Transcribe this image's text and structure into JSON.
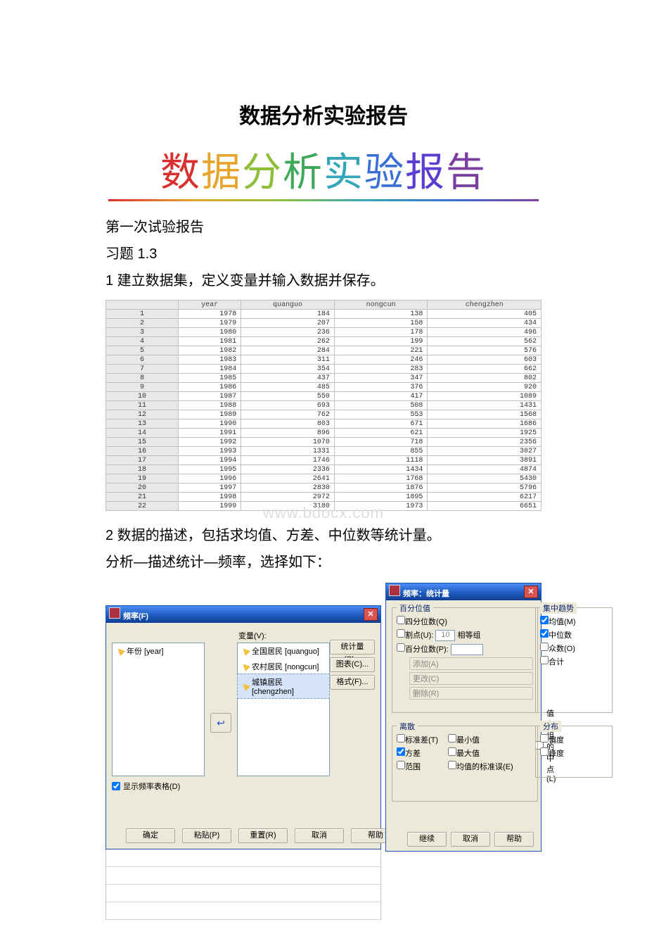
{
  "doc": {
    "title_plain": "数据分析实验报告",
    "section1": "第一次试验报告",
    "section2": "习题 1.3",
    "step1": "1 建立数据集，定义变量并输入数据并保存。",
    "step2": "2 数据的描述，包括求均值、方差、中位数等统计量。",
    "step3": "分析—描述统计—频率，选择如下：",
    "watermark": "www.bdocx.com"
  },
  "rainbow": [
    "数",
    "据",
    "分",
    "析",
    "实",
    "验",
    "报",
    "告"
  ],
  "table": {
    "headers": [
      "",
      "year",
      "quanguo",
      "nongcun",
      "chengzhen"
    ],
    "rows": [
      [
        1,
        1978,
        184,
        138,
        405
      ],
      [
        2,
        1979,
        207,
        158,
        434
      ],
      [
        3,
        1980,
        236,
        178,
        496
      ],
      [
        4,
        1981,
        262,
        199,
        562
      ],
      [
        5,
        1982,
        284,
        221,
        576
      ],
      [
        6,
        1983,
        311,
        246,
        603
      ],
      [
        7,
        1984,
        354,
        283,
        662
      ],
      [
        8,
        1985,
        437,
        347,
        802
      ],
      [
        9,
        1986,
        485,
        376,
        920
      ],
      [
        10,
        1987,
        550,
        417,
        1089
      ],
      [
        11,
        1988,
        693,
        508,
        1431
      ],
      [
        12,
        1989,
        762,
        553,
        1568
      ],
      [
        13,
        1990,
        803,
        671,
        1686
      ],
      [
        14,
        1991,
        896,
        621,
        1925
      ],
      [
        15,
        1992,
        1070,
        718,
        2356
      ],
      [
        16,
        1993,
        1331,
        855,
        3027
      ],
      [
        17,
        1994,
        1746,
        1118,
        3891
      ],
      [
        18,
        1995,
        2336,
        1434,
        4874
      ],
      [
        19,
        1996,
        2641,
        1768,
        5430
      ],
      [
        20,
        1997,
        2830,
        1876,
        5796
      ],
      [
        21,
        1998,
        2972,
        1895,
        6217
      ],
      [
        22,
        1999,
        3180,
        1973,
        6651
      ]
    ]
  },
  "dlg1": {
    "title": "频率(F)",
    "var_label": "变量(V):",
    "left_items": [
      "年份 [year]"
    ],
    "right_items": [
      "全国居民 [quanguo]",
      "农村居民 [nongcun]",
      "城镇居民 [chengzhen]"
    ],
    "side_btns": [
      "统计量(S)...",
      "图表(C)...",
      "格式(F)..."
    ],
    "show_table": "显示频率表格(D)",
    "buttons": [
      "确定",
      "粘贴(P)",
      "重置(R)",
      "取消",
      "帮助"
    ]
  },
  "dlg2": {
    "title": "频率：统计量",
    "g1": {
      "label": "百分位值",
      "quart": "四分位数(Q)",
      "cut": "割点(U):",
      "cut_val": "10",
      "cut_suffix": "相等组",
      "pct": "百分位数(P):",
      "add": "添加(A)",
      "chg": "更改(C)",
      "del": "删除(R)"
    },
    "g2": {
      "label": "集中趋势",
      "mean": "均值(M)",
      "median": "中位数",
      "mode": "众数(O)",
      "sum": "合计"
    },
    "midchk": "值为组的中点(L)",
    "g3": {
      "label": "离散",
      "sd": "标准差(T)",
      "var": "方差",
      "rng": "范围",
      "min": "最小值",
      "max": "最大值",
      "se": "均值的标准误(E)"
    },
    "g4": {
      "label": "分布",
      "skew": "偏度",
      "kurt": "峰度"
    },
    "buttons": [
      "继续",
      "取消",
      "帮助"
    ]
  }
}
